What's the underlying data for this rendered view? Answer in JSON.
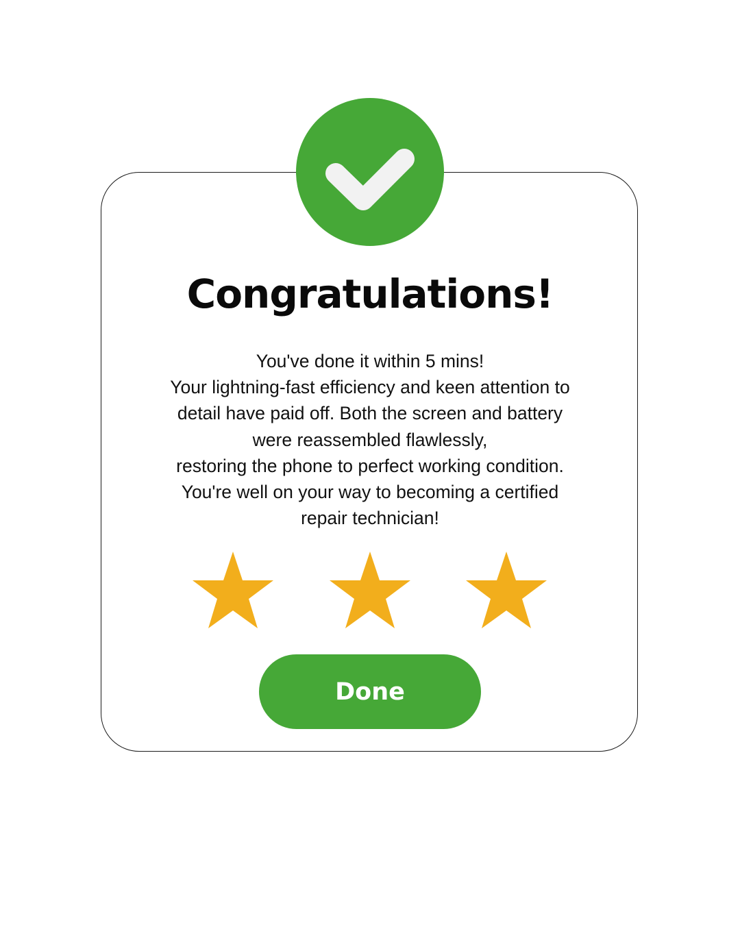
{
  "dialog": {
    "title": "Congratulations!",
    "message_lines": [
      "You've done it within 5 mins!",
      "Your lightning-fast efficiency and keen attention to",
      "detail have paid off. Both the screen and battery",
      "were reassembled flawlessly,",
      "restoring the phone to perfect working condition.",
      "You're well on your way to becoming a certified",
      "repair technician!"
    ],
    "rating": {
      "earned": 3,
      "total": 3,
      "icon": "star-icon"
    },
    "badge_icon": "checkmark-icon",
    "done_label": "Done"
  },
  "colors": {
    "accent_green": "#46a837",
    "star_gold": "#f2ae1c",
    "check_white": "#f2f2f2",
    "text": "#111111"
  }
}
